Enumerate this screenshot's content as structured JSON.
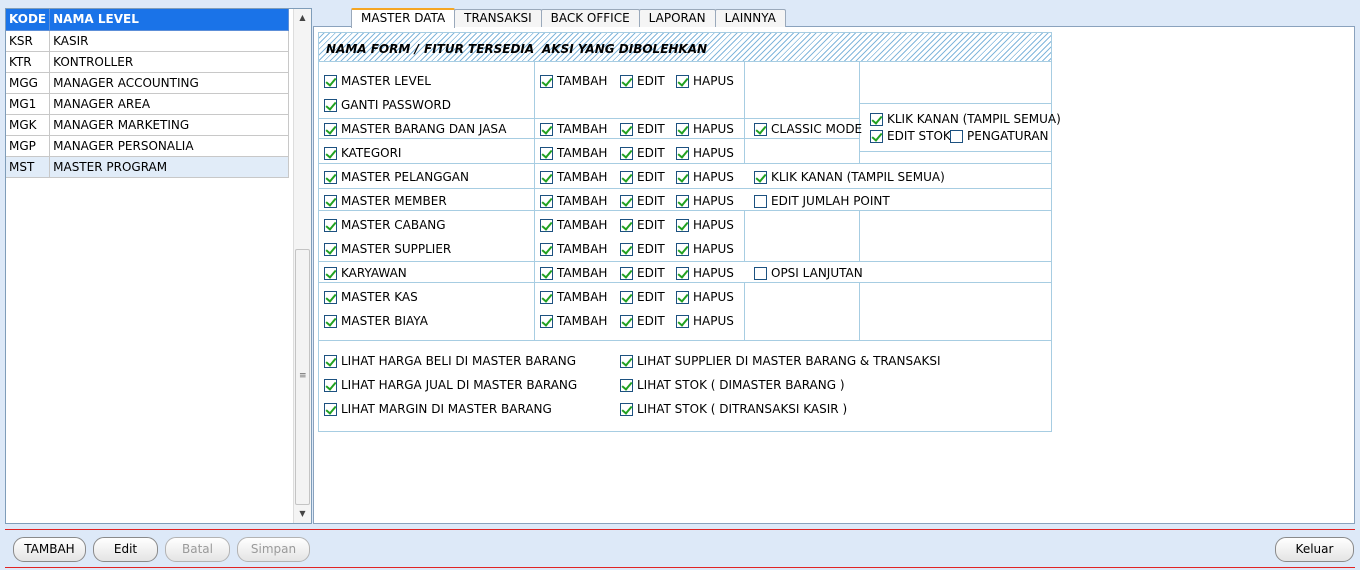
{
  "levels": {
    "headers": [
      "KODE",
      "NAMA LEVEL"
    ],
    "rows": [
      [
        "KSR",
        "KASIR"
      ],
      [
        "KTR",
        "KONTROLLER"
      ],
      [
        "MGG",
        "MANAGER ACCOUNTING"
      ],
      [
        "MG1",
        "MANAGER AREA"
      ],
      [
        "MGK",
        "MANAGER MARKETING"
      ],
      [
        "MGP",
        "MANAGER PERSONALIA"
      ],
      [
        "MST",
        "MASTER PROGRAM"
      ]
    ],
    "selected_index": 6
  },
  "scrollbar_grip": "≡",
  "tabs": [
    "MASTER DATA",
    "TRANSAKSI",
    "BACK OFFICE",
    "LAPORAN",
    "LAINNYA"
  ],
  "active_tab": 0,
  "grid": {
    "header_form": "NAMA FORM /",
    "header_fitur": "FITUR TERSEDIA",
    "header_aksi": "AKSI YANG DIBOLEHKAN"
  },
  "checks": {
    "master_level": {
      "label": "MASTER LEVEL",
      "checked": true
    },
    "ganti_password": {
      "label": "GANTI PASSWORD",
      "checked": true
    },
    "master_barang": {
      "label": "MASTER BARANG DAN JASA",
      "checked": true
    },
    "kategori": {
      "label": "KATEGORI",
      "checked": true
    },
    "master_pelanggan": {
      "label": "MASTER PELANGGAN",
      "checked": true
    },
    "master_member": {
      "label": "MASTER MEMBER",
      "checked": true
    },
    "master_cabang": {
      "label": "MASTER CABANG",
      "checked": true
    },
    "master_supplier": {
      "label": "MASTER SUPPLIER",
      "checked": true
    },
    "karyawan": {
      "label": "KARYAWAN",
      "checked": true
    },
    "master_kas": {
      "label": "MASTER KAS",
      "checked": true
    },
    "master_biaya": {
      "label": "MASTER BIAYA",
      "checked": true
    },
    "tambah_label": "TAMBAH",
    "edit_label": "EDIT",
    "hapus_label": "HAPUS",
    "classic_mode": {
      "label": "CLASSIC MODE",
      "checked": true
    },
    "klik_kanan_barang": {
      "label": "KLIK KANAN (TAMPIL SEMUA)",
      "checked": true
    },
    "edit_stok": {
      "label": "EDIT STOK",
      "checked": true
    },
    "pengaturan": {
      "label": "PENGATURAN",
      "checked": false
    },
    "klik_kanan_pelanggan": {
      "label": "KLIK KANAN (TAMPIL SEMUA)",
      "checked": true
    },
    "edit_jumlah_point": {
      "label": "EDIT JUMLAH POINT",
      "checked": false
    },
    "opsi_lanjutan": {
      "label": "OPSI LANJUTAN",
      "checked": false
    },
    "lihat_harga_beli": {
      "label": "LIHAT HARGA BELI DI MASTER BARANG",
      "checked": true
    },
    "lihat_harga_jual": {
      "label": "LIHAT HARGA JUAL DI MASTER BARANG",
      "checked": true
    },
    "lihat_margin": {
      "label": "LIHAT MARGIN DI MASTER BARANG",
      "checked": true
    },
    "lihat_supplier": {
      "label": "LIHAT SUPPLIER DI MASTER BARANG & TRANSAKSI",
      "checked": true
    },
    "lihat_stok_master": {
      "label": "LIHAT STOK ( DIMASTER BARANG )",
      "checked": true
    },
    "lihat_stok_kasir": {
      "label": "LIHAT STOK ( DITRANSAKSI KASIR )",
      "checked": true
    }
  },
  "buttons": {
    "tambah": "TAMBAH",
    "edit": "Edit",
    "batal": "Batal",
    "simpan": "Simpan",
    "keluar": "Keluar"
  },
  "colors": {
    "header_blue": "#1a73e8",
    "check_green": "#21a121",
    "separator_red": "#e02424",
    "tab_accent": "#f5a623"
  }
}
